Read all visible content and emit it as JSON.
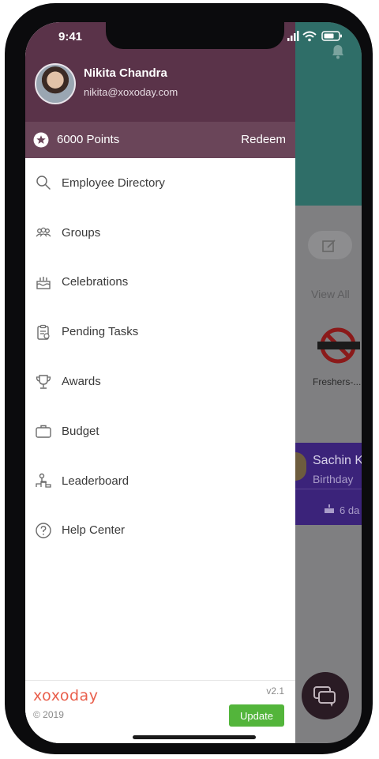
{
  "status_bar": {
    "time": "9:41"
  },
  "user": {
    "name": "Nikita Chandra",
    "email": "nikita@xoxoday.com"
  },
  "points": {
    "label": "6000 Points",
    "action": "Redeem"
  },
  "menu": {
    "items": [
      {
        "label": "Employee Directory",
        "icon": "search-icon"
      },
      {
        "label": "Groups",
        "icon": "groups-icon"
      },
      {
        "label": "Celebrations",
        "icon": "cake-icon"
      },
      {
        "label": "Pending Tasks",
        "icon": "clipboard-icon"
      },
      {
        "label": "Awards",
        "icon": "trophy-icon"
      },
      {
        "label": "Budget",
        "icon": "briefcase-icon"
      },
      {
        "label": "Leaderboard",
        "icon": "leaderboard-icon"
      },
      {
        "label": "Help Center",
        "icon": "help-icon"
      }
    ]
  },
  "footer": {
    "brand": "xoxoday",
    "copyright": "© 2019",
    "version": "v2.1",
    "update_label": "Update"
  },
  "background": {
    "view_all": "View All",
    "event_title": "Freshers-...",
    "card_name": "Sachin K",
    "card_subtitle": "Birthday",
    "card_days": "6 da"
  },
  "colors": {
    "header": "#5a3349",
    "points_bar": "#6a4559",
    "update_button": "#53b53b",
    "brand": "#e95f4c"
  }
}
